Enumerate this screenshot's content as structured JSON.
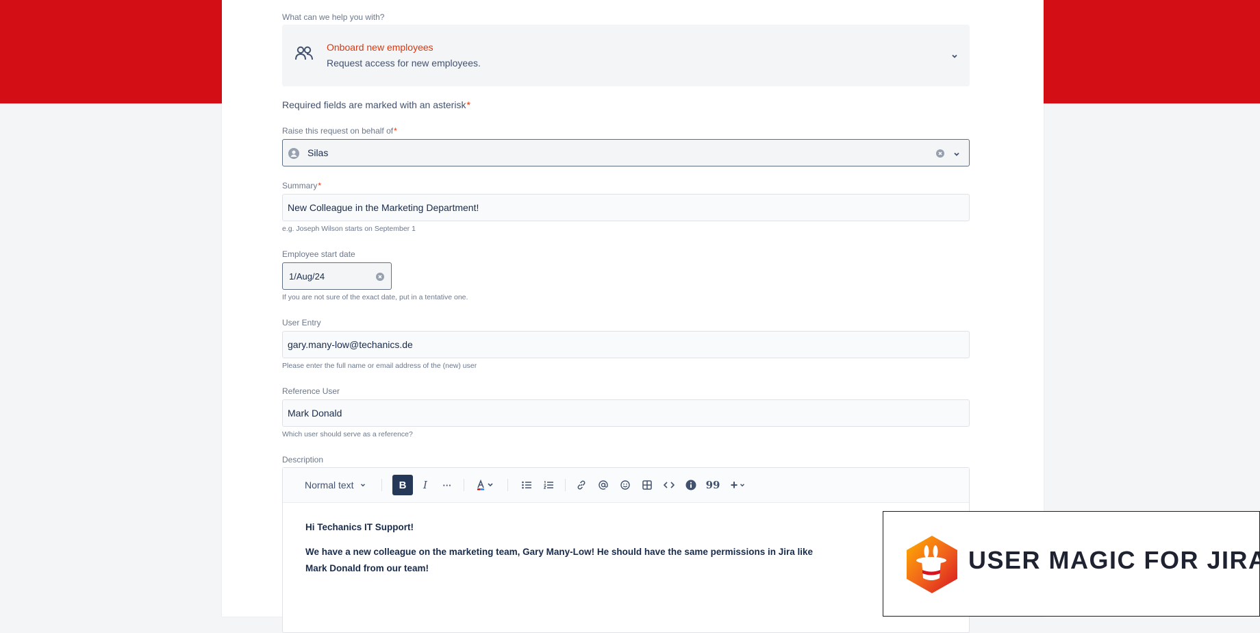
{
  "request_type": {
    "question_label": "What can we help you with?",
    "title": "Onboard new employees",
    "description": "Request access for new employees."
  },
  "required_note": "Required fields are marked with an asterisk",
  "asterisk": "*",
  "on_behalf": {
    "label": "Raise this request on behalf of",
    "value": "Silas"
  },
  "summary": {
    "label": "Summary",
    "value": "New Colleague in the Marketing Department!",
    "helper": "e.g. Joseph Wilson starts on September 1"
  },
  "start_date": {
    "label": "Employee start date",
    "value": "1/Aug/24",
    "helper": "If you are not sure of the exact date, put in a tentative one."
  },
  "user_entry": {
    "label": "User Entry",
    "value": "gary.many-low@techanics.de",
    "helper": "Please enter the full name or email address of the (new) user"
  },
  "reference_user": {
    "label": "Reference User",
    "value": "Mark Donald",
    "helper": "Which user should serve as a reference?"
  },
  "description": {
    "label": "Description",
    "toolbar": {
      "text_style": "Normal text",
      "bold": "B",
      "italic": "I",
      "more": "···",
      "quote": "99",
      "insert": "+"
    },
    "paragraphs": [
      "Hi Techanics IT Support!",
      "We have a new colleague on the marketing team, Gary Many-Low! He should have the same permissions in Jira like",
      "Mark Donald from our  team!"
    ]
  },
  "brand": {
    "text": "USER MAGIC FOR JIRA"
  },
  "colors": {
    "brand_red": "#d30e14",
    "accent_red": "#de350b",
    "dark_navy": "#253858"
  }
}
